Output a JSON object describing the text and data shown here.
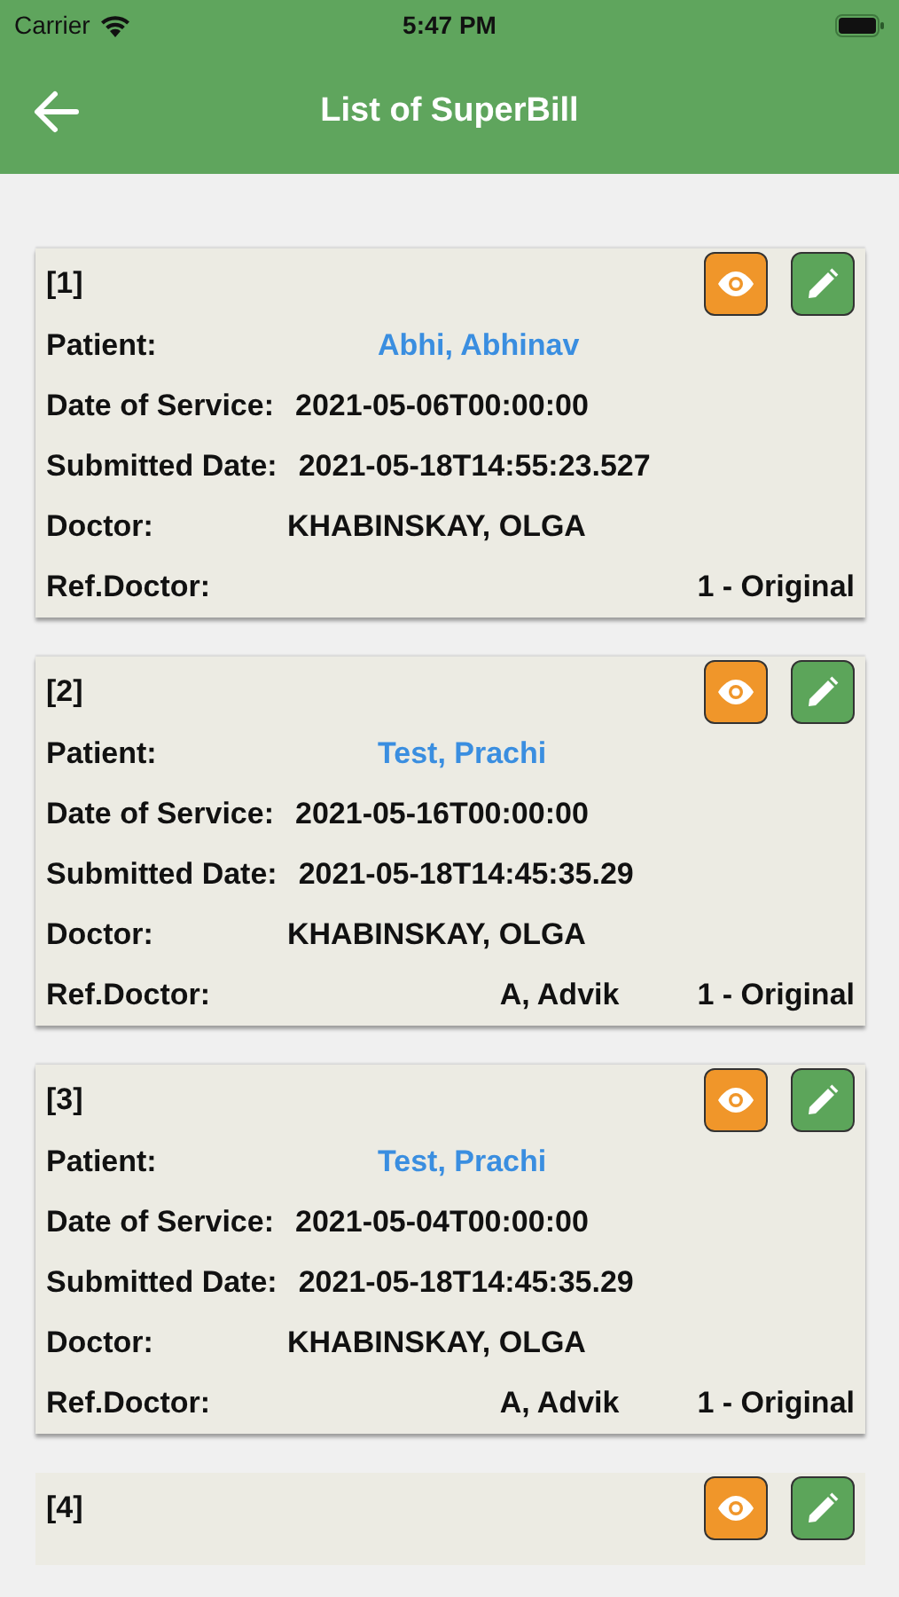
{
  "status_bar": {
    "carrier": "Carrier",
    "time": "5:47 PM"
  },
  "header": {
    "title": "List of SuperBill"
  },
  "bills": [
    {
      "index": "[1]",
      "fields": [
        {
          "kind": "patient",
          "label": "Patient:",
          "value": "Abhi, Abhinav"
        },
        {
          "kind": "service_date",
          "label": "Date of Service:",
          "value": "2021-05-06T00:00:00"
        },
        {
          "kind": "submitted_date",
          "label": "Submitted Date:",
          "value": "2021-05-18T14:55:23.527"
        },
        {
          "kind": "doctor",
          "label": "Doctor:",
          "value": "KHABINSKAY, OLGA"
        },
        {
          "kind": "ref_doctor",
          "label": "Ref.Doctor:",
          "bill_type": "1 - Original"
        }
      ]
    },
    {
      "index": "[2]",
      "fields": [
        {
          "kind": "patient",
          "label": "Patient:",
          "value": "Test, Prachi"
        },
        {
          "kind": "service_date",
          "label": "Date of Service:",
          "value": "2021-05-16T00:00:00"
        },
        {
          "kind": "submitted_date",
          "label": "Submitted Date:",
          "value": "2021-05-18T14:45:35.29"
        },
        {
          "kind": "doctor",
          "label": "Doctor:",
          "value": "KHABINSKAY, OLGA"
        },
        {
          "kind": "ref_doctor",
          "label": "Ref.Doctor:",
          "value": "A, Advik",
          "bill_type": "1 - Original"
        }
      ]
    },
    {
      "index": "[3]",
      "fields": [
        {
          "kind": "patient",
          "label": "Patient:",
          "value": "Test, Prachi"
        },
        {
          "kind": "service_date",
          "label": "Date of Service:",
          "value": "2021-05-04T00:00:00"
        },
        {
          "kind": "submitted_date",
          "label": "Submitted Date:",
          "value": "2021-05-18T14:45:35.29"
        },
        {
          "kind": "doctor",
          "label": "Doctor:",
          "value": "KHABINSKAY, OLGA"
        },
        {
          "kind": "ref_doctor",
          "label": "Ref.Doctor:",
          "value": "A, Advik",
          "bill_type": "1 - Original"
        }
      ]
    },
    {
      "index": "[4]"
    }
  ]
}
